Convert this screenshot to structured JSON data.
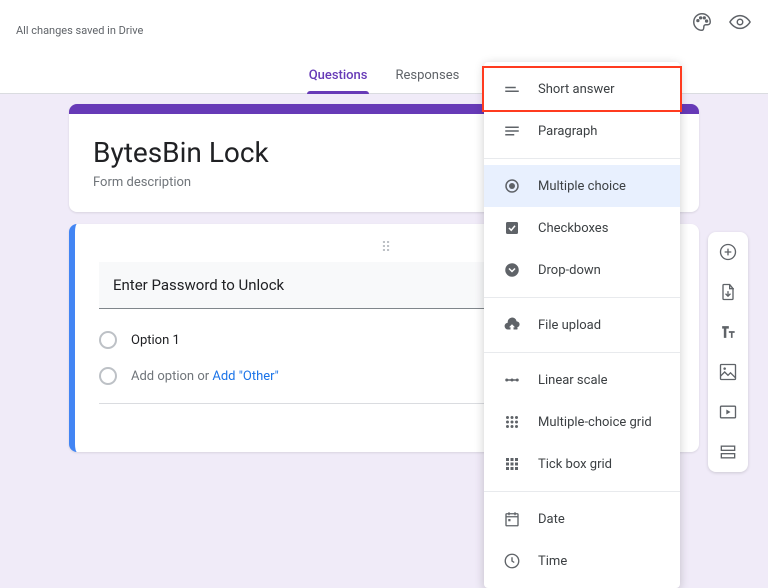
{
  "topbar": {
    "save_status": "All changes saved in Drive"
  },
  "tabs": {
    "questions": "Questions",
    "responses": "Responses"
  },
  "form": {
    "title": "BytesBin Lock",
    "description": "Form description"
  },
  "question": {
    "title": "Enter Password to Unlock",
    "option1": "Option 1",
    "add_option": "Add option",
    "or": " or ",
    "add_other": "Add \"Other\""
  },
  "dropdown": {
    "short_answer": "Short answer",
    "paragraph": "Paragraph",
    "multiple_choice": "Multiple choice",
    "checkboxes": "Checkboxes",
    "dropdown": "Drop-down",
    "file_upload": "File upload",
    "linear_scale": "Linear scale",
    "mc_grid": "Multiple-choice grid",
    "tick_grid": "Tick box grid",
    "date": "Date",
    "time": "Time",
    "selected": "multiple_choice"
  }
}
